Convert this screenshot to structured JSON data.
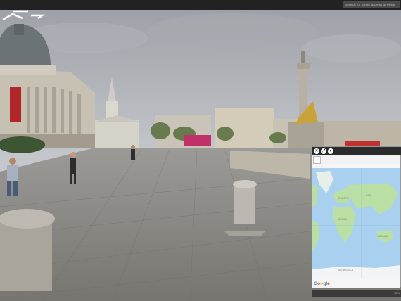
{
  "search": {
    "placeholder": "Search for Street address or Place"
  },
  "minimap": {
    "toolbar": {
      "btn1": "✕",
      "btn2": "⤢",
      "btn3": "◐"
    },
    "zoom_in": "+",
    "labels": {
      "europe": "EUROPE",
      "asia": "ASIA",
      "africa": "AFRICA",
      "oceania": "OCEANIA",
      "antarctica": "ANTARCTICA"
    },
    "google": [
      "G",
      "o",
      "o",
      "g",
      "l",
      "e"
    ],
    "google_colors": [
      "#4285F4",
      "#EA4335",
      "#FBBC05",
      "#4285F4",
      "#34A853",
      "#EA4335"
    ]
  },
  "bottom_bar": {
    "label": "Info"
  },
  "colors": {
    "sky": "#b8bcc2",
    "pavement": "#8a8987",
    "ocean": "#a9d1ef",
    "land": "#b9dfa5",
    "map_bg": "#f5f5f5"
  }
}
